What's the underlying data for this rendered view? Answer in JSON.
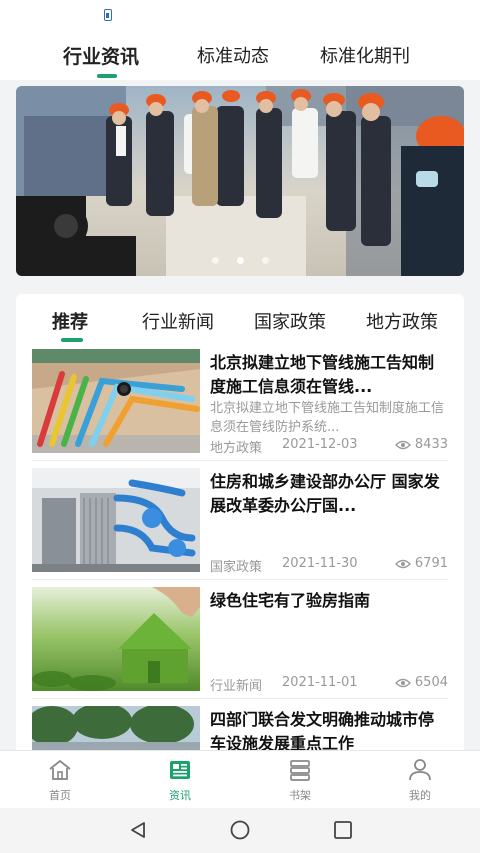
{
  "top_tabs": [
    {
      "label": "行业资讯",
      "active": true
    },
    {
      "label": "标准动态",
      "active": false
    },
    {
      "label": "标准化期刊",
      "active": false
    }
  ],
  "banner": {
    "dots": 3,
    "active_dot": 1
  },
  "sub_tabs": [
    {
      "label": "推荐",
      "active": true
    },
    {
      "label": "行业新闻",
      "active": false
    },
    {
      "label": "国家政策",
      "active": false
    },
    {
      "label": "地方政策",
      "active": false
    }
  ],
  "news": [
    {
      "title": "北京拟建立地下管线施工告知制度施工信息须在管线...",
      "summary": "北京拟建立地下管线施工告知制度施工信息须在管线防护系统...",
      "category": "地方政策",
      "date": "2021-12-03",
      "views": "8433"
    },
    {
      "title": "住房和城乡建设部办公厅 国家发展改革委办公厅国...",
      "summary": "",
      "category": "国家政策",
      "date": "2021-11-30",
      "views": "6791"
    },
    {
      "title": "绿色住宅有了验房指南",
      "summary": "",
      "category": "行业新闻",
      "date": "2021-11-01",
      "views": "6504"
    },
    {
      "title": "四部门联合发文明确推动城市停车设施发展重点工作",
      "summary": "",
      "category": "",
      "date": "",
      "views": ""
    }
  ],
  "bottom_nav": [
    {
      "label": "首页",
      "icon": "home-icon",
      "active": false
    },
    {
      "label": "资讯",
      "icon": "news-icon",
      "active": true
    },
    {
      "label": "书架",
      "icon": "bookshelf-icon",
      "active": false
    },
    {
      "label": "我的",
      "icon": "profile-icon",
      "active": false
    }
  ],
  "colors": {
    "accent": "#1aa26b",
    "background": "#f2f3f5",
    "muted_text": "#999999"
  }
}
